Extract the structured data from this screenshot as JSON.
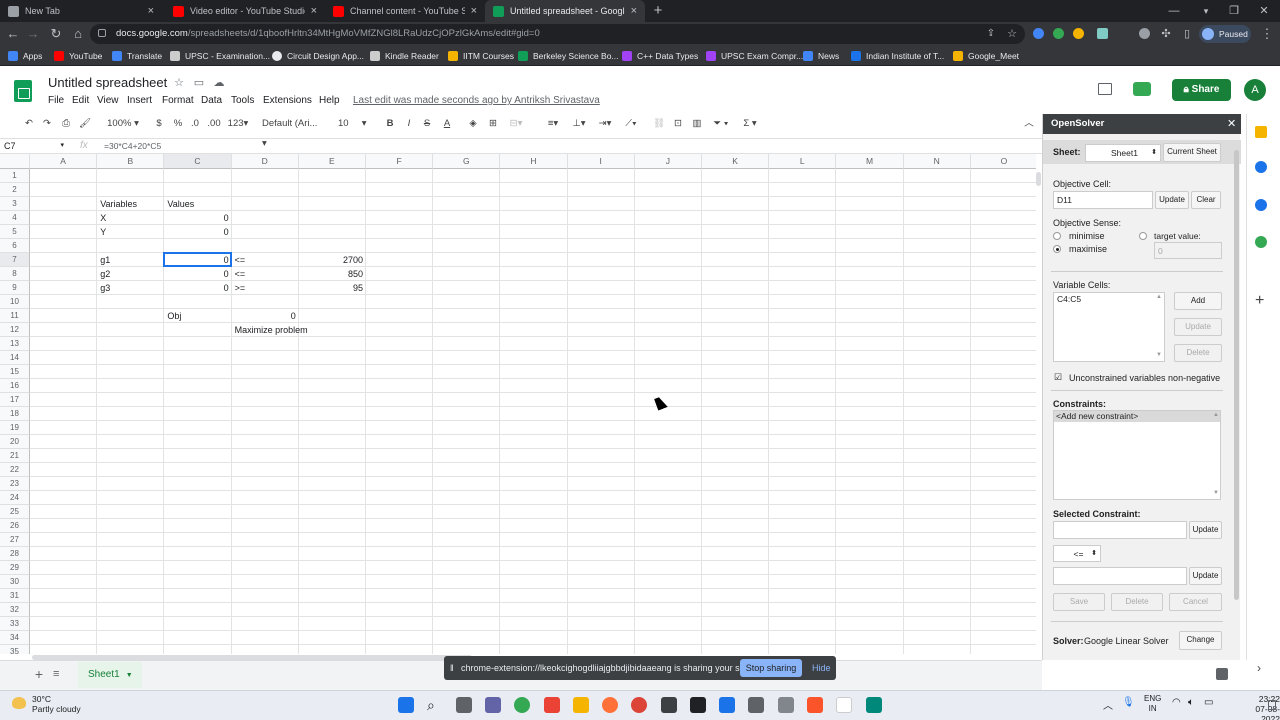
{
  "browser": {
    "tabs": [
      {
        "title": "New Tab",
        "color": "#9aa0a6"
      },
      {
        "title": "Video editor - YouTube Studio",
        "color": "#ff0000"
      },
      {
        "title": "Channel content - YouTube Studio",
        "color": "#ff0000"
      },
      {
        "title": "Untitled spreadsheet - Google Sheets",
        "color": "#0f9d58"
      }
    ],
    "url_domain": "docs.google.com",
    "url_path": "/spreadsheets/d/1qboofHrltn34MtHgMoVMfZNGl8LRaUdzCjOPzlGkAms/edit#gid=0",
    "profile_status": "Paused",
    "bookmarks": [
      "Apps",
      "YouTube",
      "Translate",
      "UPSC - Examination...",
      "Circuit Design App...",
      "Kindle Reader",
      "IITM Courses",
      "Berkeley Science Bo...",
      "C++ Data Types",
      "UPSC Exam Compr...",
      "News",
      "Indian Institute of T...",
      "Google_Meet"
    ]
  },
  "sheets": {
    "title": "Untitled spreadsheet",
    "menus": [
      "File",
      "Edit",
      "View",
      "Insert",
      "Format",
      "Data",
      "Tools",
      "Extensions",
      "Help"
    ],
    "last_edit": "Last edit was made seconds ago by Antriksh Srivastava",
    "share_label": "Share",
    "account_initial": "A",
    "toolbar": {
      "zoom": "100%",
      "currency": "$",
      "percent": "%",
      "dec_less": ".0",
      "dec_more": ".00",
      "format_more": "123",
      "font": "Default (Ari...",
      "font_size": "10",
      "bold": "B",
      "italic": "I",
      "strike": "S",
      "textcolor": "A"
    },
    "name_box": "C7",
    "fx": "fx",
    "formula": "=30*C4+20*C5",
    "columns": [
      "A",
      "B",
      "C",
      "D",
      "E",
      "F",
      "G",
      "H",
      "I",
      "J",
      "K",
      "L",
      "M",
      "N",
      "O"
    ],
    "rows": [
      "1",
      "2",
      "3",
      "4",
      "5",
      "6",
      "7",
      "8",
      "9",
      "10",
      "11",
      "12",
      "13",
      "14",
      "15",
      "16",
      "17",
      "18",
      "19",
      "20",
      "21",
      "22",
      "23",
      "24",
      "25",
      "26",
      "27",
      "28",
      "29",
      "30",
      "31",
      "32",
      "33",
      "34",
      "35"
    ],
    "cells": {
      "B3": "Variables",
      "C3": "Values",
      "B4": "X",
      "C4": "0",
      "B5": "Y",
      "C5": "0",
      "B7": "g1",
      "C7": "0",
      "D7": "<=",
      "E7": "2700",
      "B8": "g2",
      "C8": "0",
      "D8": "<=",
      "E8": "850",
      "B9": "g3",
      "C9": "0",
      "D9": ">=",
      "E9": "95",
      "C11": "Obj",
      "D11": "0",
      "D12": "Maximize problem"
    },
    "sheet_tab": "Sheet1",
    "sharing_banner": {
      "text": "chrome-extension://lkeokcighogdliiajgbbdjibidaaeang is sharing your screen.",
      "stop": "Stop sharing",
      "hide": "Hide"
    }
  },
  "opensolver": {
    "title": "OpenSolver",
    "sheet_label": "Sheet:",
    "sheet_value": "Sheet1",
    "current_sheet": "Current Sheet",
    "objective_cell_label": "Objective Cell:",
    "objective_cell": "D11",
    "update": "Update",
    "clear": "Clear",
    "objective_sense_label": "Objective Sense:",
    "minimise": "minimise",
    "maximise": "maximise",
    "target_value": "target value:",
    "target_placeholder": "0",
    "variable_cells_label": "Variable Cells:",
    "variable_cells": "C4:C5",
    "add": "Add",
    "delete": "Delete",
    "nonneg_label": "Unconstrained variables non-negative",
    "constraints_label": "Constraints:",
    "constraints": [
      "<Add new constraint>"
    ],
    "selected_constraint_label": "Selected Constraint:",
    "relation": "<=",
    "save": "Save",
    "cancel": "Cancel",
    "solver_label": "Solver:",
    "solver_value": "Google Linear Solver",
    "change": "Change"
  },
  "taskbar": {
    "temp": "30°C",
    "weather": "Partly cloudy",
    "lang": "ENG",
    "region": "IN",
    "time": "23:22",
    "date": "07-08-2022"
  }
}
